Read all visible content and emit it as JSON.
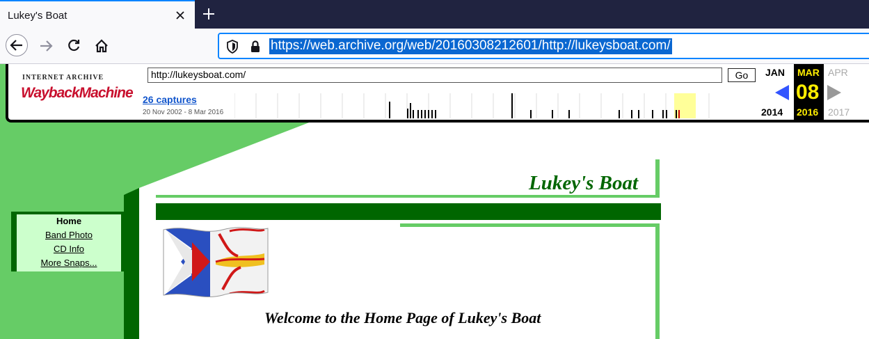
{
  "browser": {
    "tab_title": "Lukey's Boat",
    "url": "https://web.archive.org/web/20160308212601/http://lukeysboat.com/"
  },
  "icons": [
    "close-icon",
    "plus-icon",
    "back-arrow-icon",
    "forward-arrow-icon",
    "reload-icon",
    "home-icon",
    "shield-icon",
    "lock-icon"
  ],
  "wayback": {
    "logo_top": "INTERNET ARCHIVE",
    "logo_main": "WaybackMachine",
    "input_value": "http://lukeysboat.com/",
    "go_label": "Go",
    "captures": "26 captures",
    "range": "20 Nov 2002 - 8 Mar 2016",
    "prev_month": "JAN",
    "cur_month": "MAR",
    "next_month": "APR",
    "day": "08",
    "prev_year": "2014",
    "cur_year": "2016",
    "next_year": "2017"
  },
  "site": {
    "title": "Lukey's Boat",
    "welcome": "Welcome to the Home Page of Lukey's Boat",
    "nav": [
      "Home",
      "Band Photo",
      "CD Info",
      "More Snaps..."
    ]
  },
  "colors": {
    "site_green_dark": "#006600",
    "site_green_light": "#66cc66",
    "nav_bg": "#ccffcc",
    "accent_blue": "#0a84ff"
  }
}
